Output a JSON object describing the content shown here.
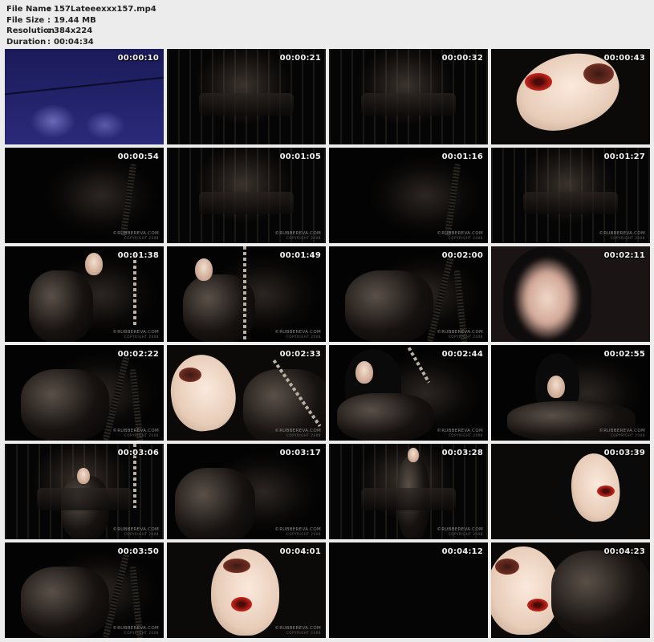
{
  "info": {
    "file_name_key": "File Name",
    "file_name": "157Lateeexxx157.mp4",
    "file_size_key": "File Size",
    "file_size": "19.44 MB",
    "resolution_key": "Resolution",
    "resolution": "384x224",
    "duration_key": "Duration",
    "duration": "00:04:34",
    "separator": ":"
  },
  "thumbnails": [
    {
      "time": "00:00:10",
      "watermark": false
    },
    {
      "time": "00:00:21",
      "watermark": false
    },
    {
      "time": "00:00:32",
      "watermark": false
    },
    {
      "time": "00:00:43",
      "watermark": false
    },
    {
      "time": "00:00:54",
      "watermark": true
    },
    {
      "time": "00:01:05",
      "watermark": true
    },
    {
      "time": "00:01:16",
      "watermark": true
    },
    {
      "time": "00:01:27",
      "watermark": true
    },
    {
      "time": "00:01:38",
      "watermark": true
    },
    {
      "time": "00:01:49",
      "watermark": true
    },
    {
      "time": "00:02:00",
      "watermark": true
    },
    {
      "time": "00:02:11",
      "watermark": false
    },
    {
      "time": "00:02:22",
      "watermark": true
    },
    {
      "time": "00:02:33",
      "watermark": true
    },
    {
      "time": "00:02:44",
      "watermark": true
    },
    {
      "time": "00:02:55",
      "watermark": true
    },
    {
      "time": "00:03:06",
      "watermark": true
    },
    {
      "time": "00:03:17",
      "watermark": true
    },
    {
      "time": "00:03:28",
      "watermark": true
    },
    {
      "time": "00:03:39",
      "watermark": false
    },
    {
      "time": "00:03:50",
      "watermark": true
    },
    {
      "time": "00:04:01",
      "watermark": true
    },
    {
      "time": "00:04:12",
      "watermark": false
    },
    {
      "time": "00:04:23",
      "watermark": false
    }
  ],
  "watermark_text": "©RUBBEREVA.COM",
  "watermark_sub": "COPYRIGHT 2008"
}
